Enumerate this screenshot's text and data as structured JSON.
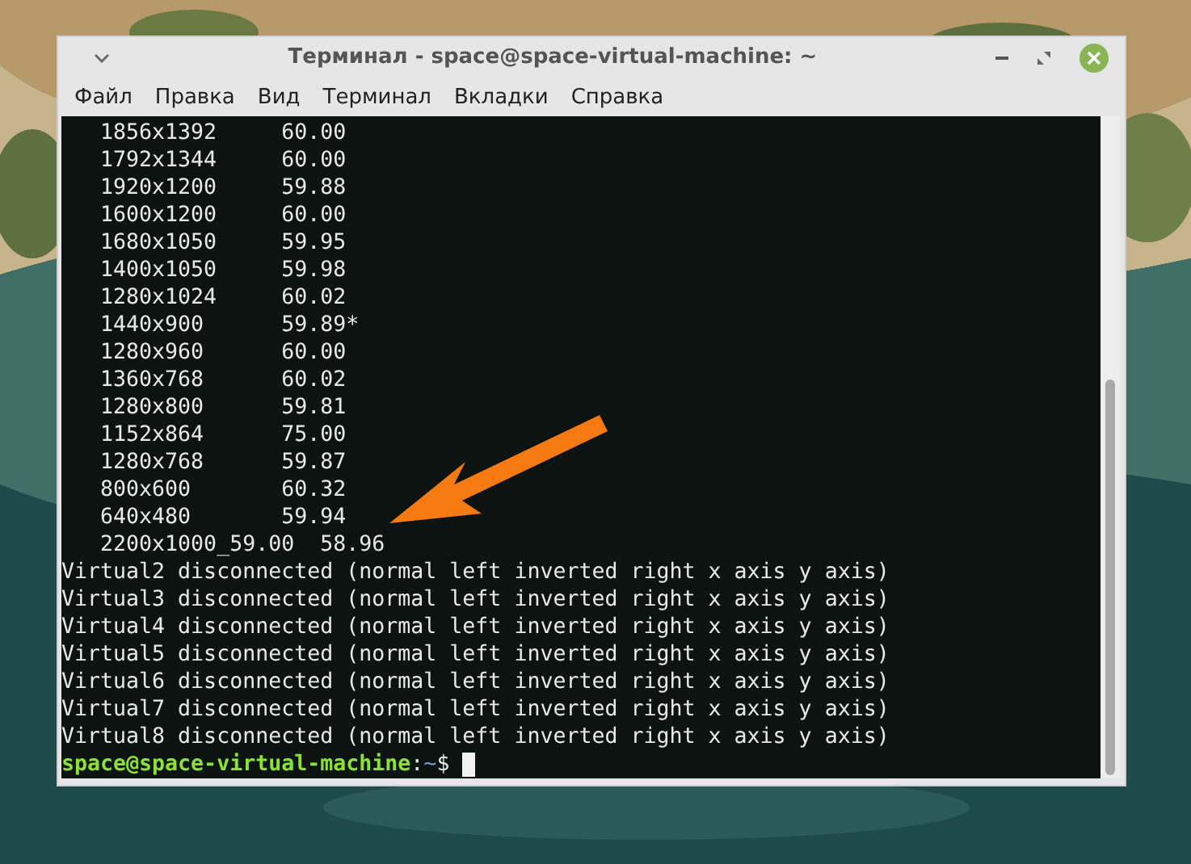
{
  "window": {
    "title": "Терминал - space@space-virtual-machine: ~"
  },
  "menu": [
    "Файл",
    "Правка",
    "Вид",
    "Терминал",
    "Вкладки",
    "Справка"
  ],
  "terminal": {
    "lines": [
      {
        "kind": "output",
        "text": "   1856x1392     60.00"
      },
      {
        "kind": "output",
        "text": "   1792x1344     60.00"
      },
      {
        "kind": "output",
        "text": "   1920x1200     59.88"
      },
      {
        "kind": "output",
        "text": "   1600x1200     60.00"
      },
      {
        "kind": "output",
        "text": "   1680x1050     59.95"
      },
      {
        "kind": "output",
        "text": "   1400x1050     59.98"
      },
      {
        "kind": "output",
        "text": "   1280x1024     60.02"
      },
      {
        "kind": "output",
        "text": "   1440x900      59.89*"
      },
      {
        "kind": "output",
        "text": "   1280x960      60.00"
      },
      {
        "kind": "output",
        "text": "   1360x768      60.02"
      },
      {
        "kind": "output",
        "text": "   1280x800      59.81"
      },
      {
        "kind": "output",
        "text": "   1152x864      75.00"
      },
      {
        "kind": "output",
        "text": "   1280x768      59.87"
      },
      {
        "kind": "output",
        "text": "   800x600       60.32"
      },
      {
        "kind": "output",
        "text": "   640x480       59.94"
      },
      {
        "kind": "output",
        "text": "   2200x1000_59.00  58.96"
      },
      {
        "kind": "output",
        "text": "Virtual2 disconnected (normal left inverted right x axis y axis)"
      },
      {
        "kind": "output",
        "text": "Virtual3 disconnected (normal left inverted right x axis y axis)"
      },
      {
        "kind": "output",
        "text": "Virtual4 disconnected (normal left inverted right x axis y axis)"
      },
      {
        "kind": "output",
        "text": "Virtual5 disconnected (normal left inverted right x axis y axis)"
      },
      {
        "kind": "output",
        "text": "Virtual6 disconnected (normal left inverted right x axis y axis)"
      },
      {
        "kind": "output",
        "text": "Virtual7 disconnected (normal left inverted right x axis y axis)"
      },
      {
        "kind": "output",
        "text": "Virtual8 disconnected (normal left inverted right x axis y axis)"
      },
      {
        "kind": "prompt",
        "user_host": "space@space-virtual-machine",
        "separator": ":",
        "path": "~",
        "symbol": "$"
      }
    ]
  }
}
